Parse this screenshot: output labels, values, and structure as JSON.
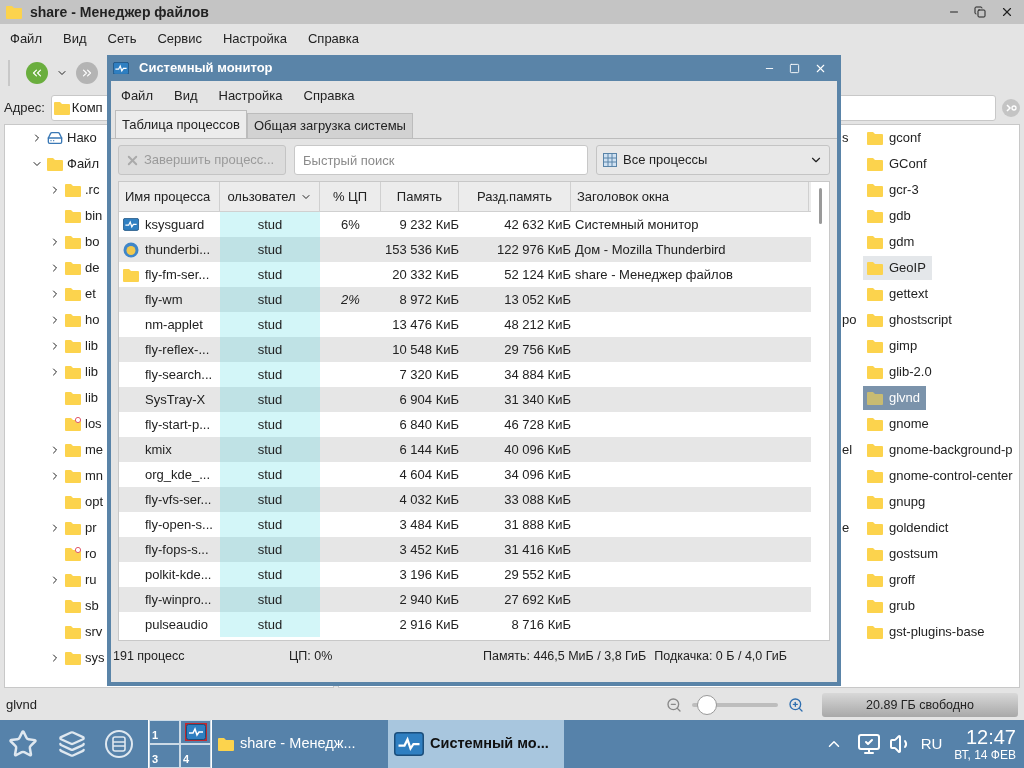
{
  "file_manager": {
    "title": "share - Менеджер файлов",
    "menu": [
      "Файл",
      "Вид",
      "Сеть",
      "Сервис",
      "Настройка",
      "Справка"
    ],
    "address_label": "Адрес:",
    "address_value": "Комп",
    "tree": [
      {
        "label": "Нако",
        "kind": "drive",
        "expandable": true,
        "expanded": false
      },
      {
        "label": "Файл",
        "kind": "folder",
        "expandable": true,
        "expanded": true,
        "children": [
          {
            "label": ".rc",
            "kind": "folder",
            "expandable": true,
            "expanded": false
          },
          {
            "label": "bin",
            "kind": "folder",
            "expandable": false
          },
          {
            "label": "bo",
            "kind": "folder",
            "expandable": true,
            "expanded": false
          },
          {
            "label": "de",
            "kind": "folder",
            "expandable": true,
            "expanded": false
          },
          {
            "label": "et",
            "kind": "folder",
            "expandable": true,
            "expanded": false
          },
          {
            "label": "ho",
            "kind": "folder",
            "expandable": true,
            "expanded": false
          },
          {
            "label": "lib",
            "kind": "folder",
            "expandable": true,
            "expanded": false
          },
          {
            "label": "lib",
            "kind": "folder",
            "expandable": true,
            "expanded": false
          },
          {
            "label": "lib",
            "kind": "folder",
            "expandable": false
          },
          {
            "label": "los",
            "kind": "special",
            "expandable": false
          },
          {
            "label": "me",
            "kind": "folder",
            "expandable": true,
            "expanded": false
          },
          {
            "label": "mn",
            "kind": "folder",
            "expandable": true,
            "expanded": false
          },
          {
            "label": "opt",
            "kind": "folder",
            "expandable": false
          },
          {
            "label": "pr",
            "kind": "folder",
            "expandable": true,
            "expanded": false
          },
          {
            "label": "ro",
            "kind": "special",
            "expandable": false
          },
          {
            "label": "ru",
            "kind": "folder",
            "expandable": true,
            "expanded": false
          },
          {
            "label": "sb",
            "kind": "folder",
            "expandable": false
          },
          {
            "label": "srv",
            "kind": "folder",
            "expandable": false
          },
          {
            "label": "sys",
            "kind": "folder",
            "expandable": true,
            "expanded": false
          }
        ]
      }
    ],
    "files": [
      {
        "name": "gconf",
        "fragment": "s",
        "selected": false,
        "hovered": false
      },
      {
        "name": "GConf",
        "selected": false,
        "hovered": false
      },
      {
        "name": "gcr-3",
        "selected": false,
        "hovered": false
      },
      {
        "name": "gdb",
        "selected": false,
        "hovered": false
      },
      {
        "name": "gdm",
        "selected": false,
        "hovered": false
      },
      {
        "name": "GeoIP",
        "selected": false,
        "hovered": true
      },
      {
        "name": "gettext",
        "selected": false,
        "hovered": false
      },
      {
        "name": "ghostscript",
        "fragment": "po",
        "selected": false,
        "hovered": false
      },
      {
        "name": "gimp",
        "selected": false,
        "hovered": false
      },
      {
        "name": "glib-2.0",
        "selected": false,
        "hovered": false
      },
      {
        "name": "glvnd",
        "selected": true,
        "hovered": false
      },
      {
        "name": "gnome",
        "selected": false,
        "hovered": false
      },
      {
        "name": "gnome-background-p",
        "fragment": "el",
        "selected": false,
        "hovered": false
      },
      {
        "name": "gnome-control-center",
        "selected": false,
        "hovered": false
      },
      {
        "name": "gnupg",
        "selected": false,
        "hovered": false
      },
      {
        "name": "goldendict",
        "fragment": "e",
        "selected": false,
        "hovered": false
      },
      {
        "name": "gostsum",
        "selected": false,
        "hovered": false
      },
      {
        "name": "groff",
        "selected": false,
        "hovered": false
      },
      {
        "name": "grub",
        "selected": false,
        "hovered": false
      },
      {
        "name": "gst-plugins-base",
        "selected": false,
        "hovered": false
      }
    ],
    "status": "glvnd",
    "zoom": {
      "level": 0.08
    },
    "disk_free": "20.89 ГБ свободно"
  },
  "system_monitor": {
    "title": "Системный монитор",
    "menu": [
      "Файл",
      "Вид",
      "Настройка",
      "Справка"
    ],
    "tabs": [
      {
        "label": "Таблица процессов",
        "selected": true
      },
      {
        "label": "Общая загрузка системы",
        "selected": false
      }
    ],
    "end_button": {
      "label": "Завершить процесс...",
      "disabled": true
    },
    "search": {
      "placeholder": "Быстрый поиск"
    },
    "filter": "Все процессы",
    "columns": [
      "Имя процесса",
      "ользовател",
      "% ЦП",
      "Память",
      "Разд.память",
      "Заголовок окна"
    ],
    "rows": [
      {
        "kind": "monitor",
        "name": "ksysguard",
        "user": "stud",
        "cpu": "6%",
        "cpu_italic": false,
        "memory": "9 232 КиБ",
        "shared": "42 632 КиБ",
        "window_title": "Системный монитор"
      },
      {
        "kind": "bird",
        "name": "thunderbi...",
        "user": "stud",
        "memory": "153 536 КиБ",
        "shared": "122 976 КиБ",
        "window_title": "Дом - Mozilla Thunderbird"
      },
      {
        "kind": "folder",
        "name": "fly-fm-ser...",
        "user": "stud",
        "memory": "20 332 КиБ",
        "shared": "52 124 КиБ",
        "window_title": "share - Менеджер файлов"
      },
      {
        "kind": "plain",
        "name": "fly-wm",
        "user": "stud",
        "cpu": "2%",
        "cpu_italic": true,
        "memory": "8 972 КиБ",
        "shared": "13 052 КиБ"
      },
      {
        "kind": "plain",
        "name": "nm-applet",
        "user": "stud",
        "memory": "13 476 КиБ",
        "shared": "48 212 КиБ"
      },
      {
        "kind": "plain",
        "name": "fly-reflex-...",
        "user": "stud",
        "memory": "10 548 КиБ",
        "shared": "29 756 КиБ"
      },
      {
        "kind": "plain",
        "name": "fly-search...",
        "user": "stud",
        "memory": "7 320 КиБ",
        "shared": "34 884 КиБ"
      },
      {
        "kind": "plain",
        "name": "SysTray-X",
        "user": "stud",
        "memory": "6 904 КиБ",
        "shared": "31 340 КиБ"
      },
      {
        "kind": "plain",
        "name": "fly-start-p...",
        "user": "stud",
        "memory": "6 840 КиБ",
        "shared": "46 728 КиБ"
      },
      {
        "kind": "plain",
        "name": "kmix",
        "user": "stud",
        "memory": "6 144 КиБ",
        "shared": "40 096 КиБ"
      },
      {
        "kind": "plain",
        "name": "org_kde_...",
        "user": "stud",
        "memory": "4 604 КиБ",
        "shared": "34 096 КиБ"
      },
      {
        "kind": "plain",
        "name": "fly-vfs-ser...",
        "user": "stud",
        "memory": "4 032 КиБ",
        "shared": "33 088 КиБ"
      },
      {
        "kind": "plain",
        "name": "fly-open-s...",
        "user": "stud",
        "memory": "3 484 КиБ",
        "shared": "31 888 КиБ"
      },
      {
        "kind": "plain",
        "name": "fly-fops-s...",
        "user": "stud",
        "memory": "3 452 КиБ",
        "shared": "31 416 КиБ"
      },
      {
        "kind": "plain",
        "name": "polkit-kde...",
        "user": "stud",
        "memory": "3 196 КиБ",
        "shared": "29 552 КиБ"
      },
      {
        "kind": "plain",
        "name": "fly-winpro...",
        "user": "stud",
        "memory": "2 940 КиБ",
        "shared": "27 692 КиБ"
      },
      {
        "kind": "plain",
        "name": "pulseaudio",
        "user": "stud",
        "memory": "2 916 КиБ",
        "shared": "8 716 КиБ"
      }
    ],
    "status": {
      "processes": "191 процесс",
      "cpu": "ЦП: 0%",
      "memory": "Память: 446,5 МиБ / 3,8 ГиБ",
      "swap": "Подкачка: 0 Б / 4,0 ГиБ"
    }
  },
  "taskbar": {
    "pager": [
      {
        "kind": "number",
        "label": "1"
      },
      {
        "kind": "window"
      },
      {
        "kind": "number",
        "label": "3"
      },
      {
        "kind": "number",
        "label": "4"
      }
    ],
    "tasks": [
      {
        "kind": "folder",
        "label": "share - Менедж...",
        "selected": false
      },
      {
        "kind": "monitor",
        "label": "Системный мо...",
        "selected": true
      }
    ],
    "language": "RU",
    "time": "12:47",
    "date": "ВТ, 14 ФЕВ"
  }
}
